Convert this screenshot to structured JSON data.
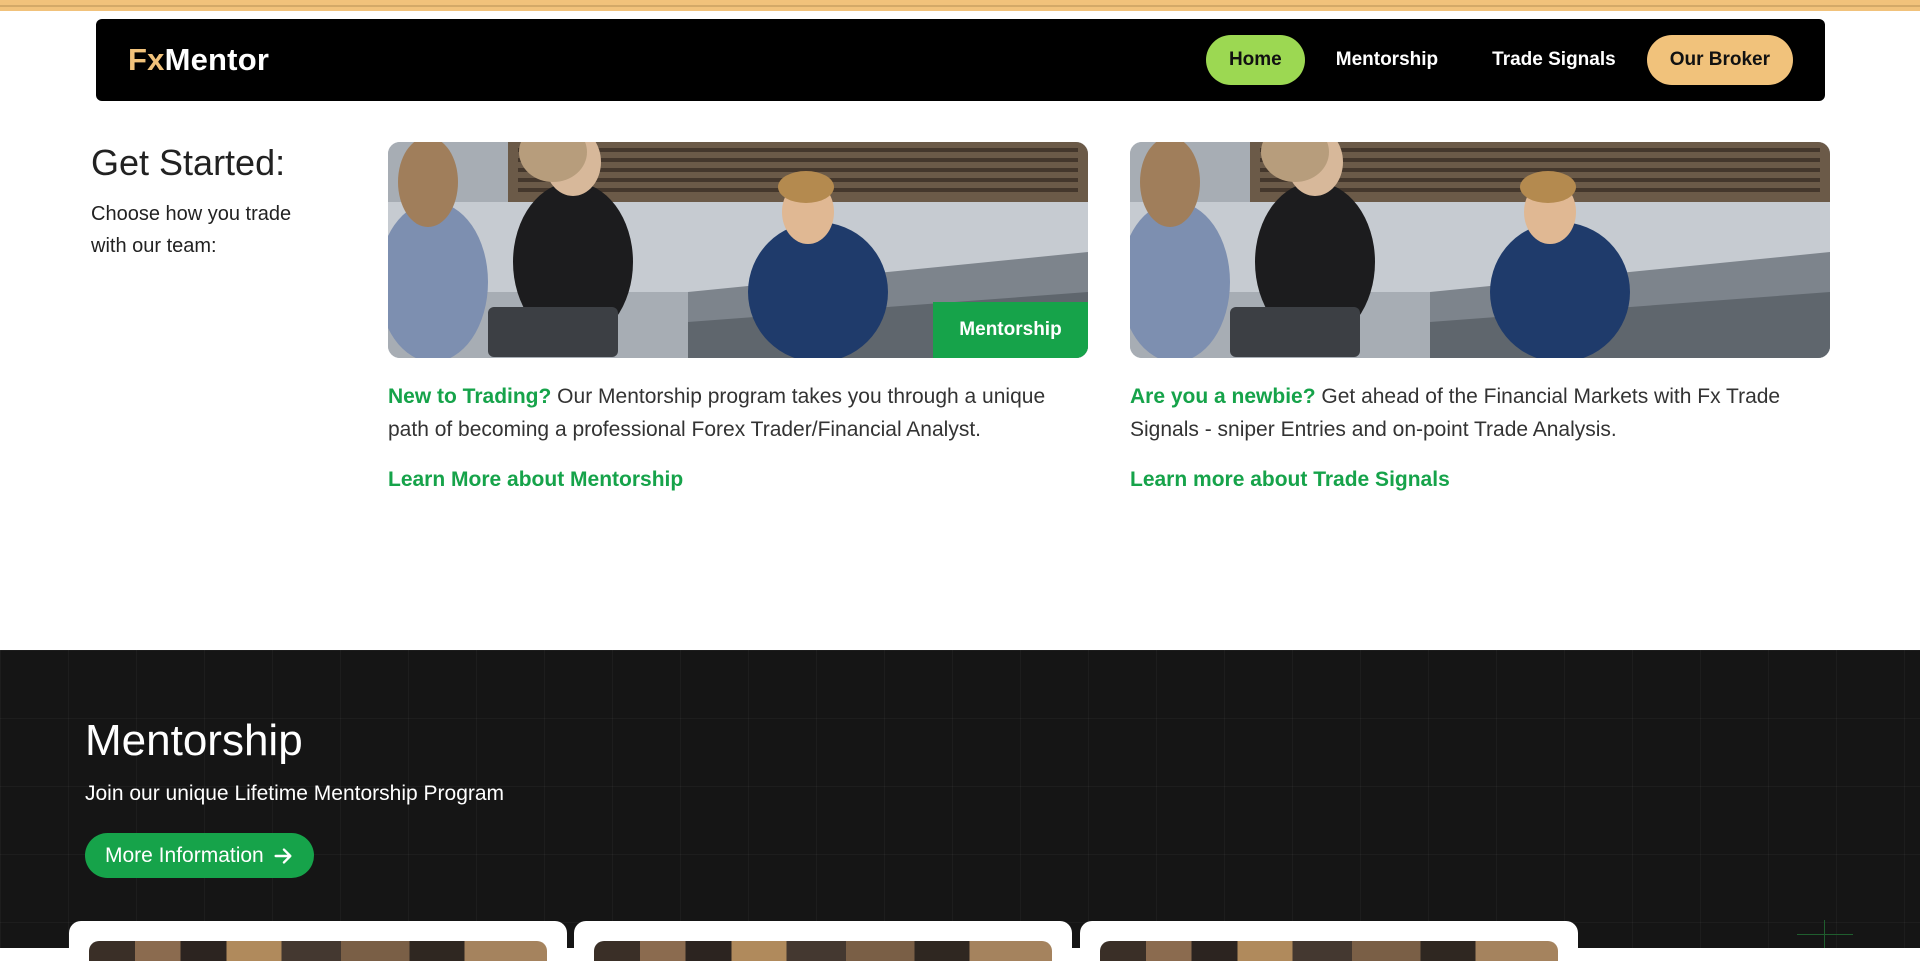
{
  "brand": {
    "prefix": "Fx",
    "name": "Mentor"
  },
  "nav": {
    "home": "Home",
    "mentorship": "Mentorship",
    "trade_signals": "Trade Signals",
    "broker": "Our Broker"
  },
  "intro": {
    "title": "Get Started:",
    "subtitle": "Choose how you trade with our team:"
  },
  "cards": [
    {
      "tag": "Mentorship",
      "highlight": "New to Trading?",
      "text": " Our Mentorship program takes you through a unique path of becoming a professional Forex Trader/Financial Analyst.",
      "link": "Learn More about Mentorship"
    },
    {
      "highlight": "Are you a newbie?",
      "text": " Get ahead of the Financial Markets with Fx Trade Signals - sniper Entries and on-point Trade Analysis.",
      "link": "Learn more about Trade Signals"
    }
  ],
  "mentorship_section": {
    "title": "Mentorship",
    "subtitle": "Join our unique Lifetime Mentorship Program",
    "button": "More Information",
    "button_icon": "arrow-right-icon"
  },
  "colors": {
    "accent_gold": "#f1c27b",
    "accent_green": "#16a34a",
    "home_pill": "#9cd852",
    "dark_bg": "#151515"
  }
}
